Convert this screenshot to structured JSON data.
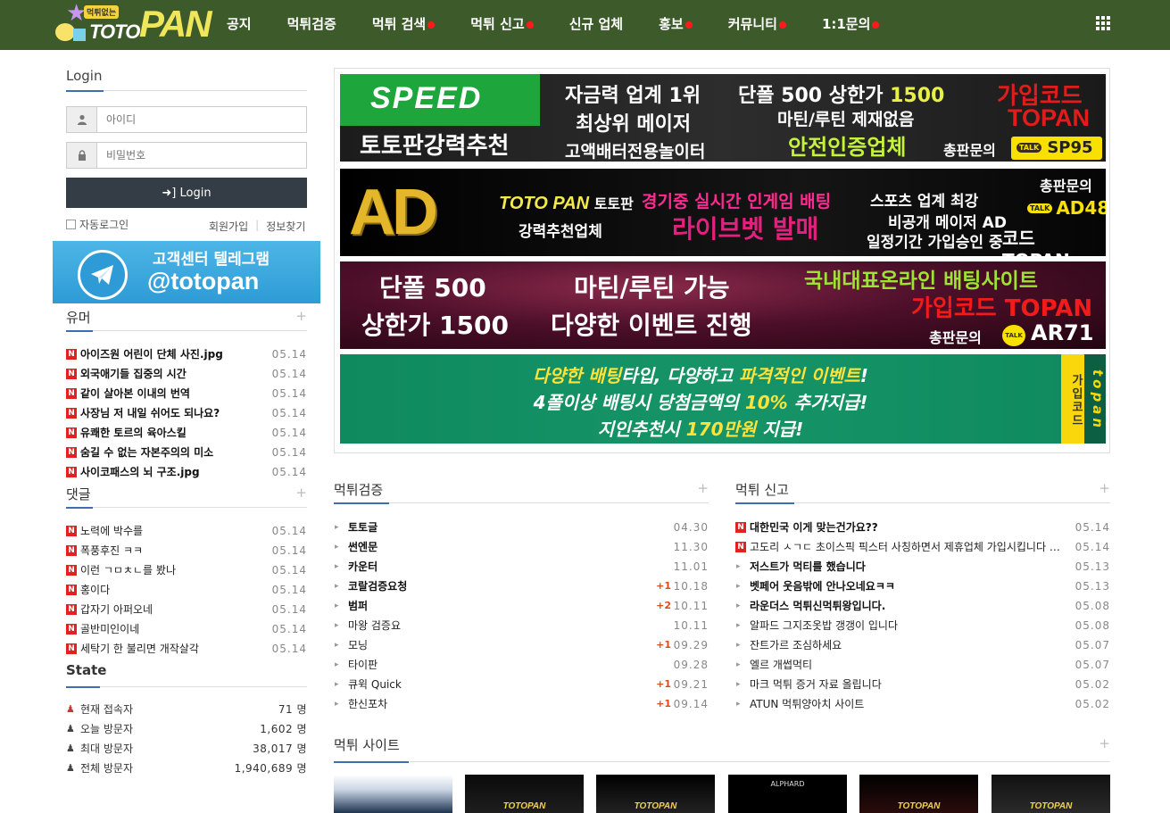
{
  "logo": {
    "tag": "먹튀없는",
    "toto": "TOTO",
    "pan": "PAN"
  },
  "nav": [
    {
      "label": "공지",
      "dot": false
    },
    {
      "label": "먹튀검증",
      "dot": false
    },
    {
      "label": "먹튀 검색",
      "dot": true
    },
    {
      "label": "먹튀 신고",
      "dot": true
    },
    {
      "label": "신규 업체",
      "dot": false
    },
    {
      "label": "홍보",
      "dot": true
    },
    {
      "label": "커뮤니티",
      "dot": true
    },
    {
      "label": "1:1문의",
      "dot": true
    }
  ],
  "login": {
    "title": "Login",
    "id_placeholder": "아이디",
    "pw_placeholder": "비밀번호",
    "button": "Login",
    "auto_login": "자동로그인",
    "signup": "회원가입",
    "find_info": "정보찾기"
  },
  "telegram": {
    "line1": "고객센터 텔레그램",
    "line2": "@totopan"
  },
  "humor": {
    "title": "유머",
    "items": [
      {
        "title": "아이즈원 어린이 단체 사진.jpg",
        "date": "05.14"
      },
      {
        "title": "외국애기들 집중의 시간",
        "date": "05.14"
      },
      {
        "title": "같이 살아본 이내의 번역",
        "date": "05.14"
      },
      {
        "title": "사장님 저 내일 쉬어도 되나요?",
        "date": "05.14"
      },
      {
        "title": "유쾌한 토르의 육아스킬",
        "date": "05.14"
      },
      {
        "title": "숨길 수 없는 자본주의의 미소",
        "date": "05.14"
      },
      {
        "title": "사이코패스의 뇌 구조.jpg",
        "date": "05.14"
      }
    ]
  },
  "comments": {
    "title": "댓글",
    "items": [
      {
        "title": "노력에 박수를",
        "date": "05.14"
      },
      {
        "title": "폭풍후진 ㅋㅋ",
        "date": "05.14"
      },
      {
        "title": "이런 ㄱㅁㅊㄴ를 봤나",
        "date": "05.14"
      },
      {
        "title": "홍이다",
        "date": "05.14"
      },
      {
        "title": "갑자기 아퍼오네",
        "date": "05.14"
      },
      {
        "title": "골반미인이네",
        "date": "05.14"
      },
      {
        "title": "세탁기 한 불리면 개작살각",
        "date": "05.14"
      }
    ]
  },
  "state": {
    "title": "State",
    "items": [
      {
        "label": "현재 접속자",
        "value": "71 명"
      },
      {
        "label": "오늘 방문자",
        "value": "1,602 명"
      },
      {
        "label": "최대 방문자",
        "value": "38,017 명"
      },
      {
        "label": "전체 방문자",
        "value": "1,940,689 명"
      }
    ]
  },
  "banners": {
    "b1": {
      "brand": "SPEED",
      "rec": "토토판강력추천",
      "a1": "자금력 업계 1위",
      "a2": "최상위 메이저",
      "a3": "고액배터전용놀이터",
      "b1a": "단폴 500 상한가 ",
      "b1b": "1500",
      "b2": "마틴/루틴 제재없음",
      "b3": "안전인증업체",
      "c1": "가입코드",
      "c2": "TOPAN",
      "c3": "총판문의",
      "talk_tag": "TALK",
      "talk": "SP95"
    },
    "b2": {
      "brand": "AD",
      "l1a": "TOTO PAN",
      "l1b": " 토토판",
      "l2": "강력추천업체",
      "m1": "경기중 실시간 인게임 배팅",
      "m2": "라이브벳 발매",
      "r1": "스포츠 업계 최강",
      "r2": "비공개 메이저 AD",
      "r3": "일정기간 가입승인 중",
      "s1": "총판문의",
      "talk_tag": "TALK",
      "s2": "AD48",
      "s3": "코드 TOPAN"
    },
    "b3": {
      "a1": "단폴 500",
      "a2": "상한가 1500",
      "b1": "마틴/루틴 가능",
      "b2": "다양한 이벤트 진행",
      "c1": "국내대표온라인 배팅사이트",
      "c2": "가입코드 TOPAN",
      "c3": "총판문의",
      "talk_tag": "TALK",
      "c4": "AR71"
    },
    "b4": {
      "l1a": "다양한 배팅",
      "l1b": "타입, 다양하고 ",
      "l1c": "파격적인 이벤트",
      "l1d": "!",
      "l2a": "4폴이상 배팅시 당첨금액의 ",
      "l2b": "10%",
      "l2c": " 추가지급!",
      "l3a": "지인추천시 ",
      "l3b": "170만원",
      "l3c": " 지급!",
      "side_code": "가입코드",
      "side_name": "topan"
    }
  },
  "verify": {
    "title": "먹튀검증",
    "items": [
      {
        "title": "토토글",
        "date": "04.30",
        "plus": "",
        "bold": true
      },
      {
        "title": "썬엔문",
        "date": "11.30",
        "plus": "",
        "bold": true
      },
      {
        "title": "카운터",
        "date": "11.01",
        "plus": "",
        "bold": true
      },
      {
        "title": "코랄검증요청",
        "date": "10.18",
        "plus": "+1",
        "bold": true
      },
      {
        "title": "범퍼",
        "date": "10.11",
        "plus": "+2",
        "bold": true
      },
      {
        "title": "마왕 검증요",
        "date": "10.11",
        "plus": "",
        "bold": false
      },
      {
        "title": "모닝",
        "date": "09.29",
        "plus": "+1",
        "bold": false
      },
      {
        "title": "타이판",
        "date": "09.28",
        "plus": "",
        "bold": false
      },
      {
        "title": "큐윅 Quick",
        "date": "09.21",
        "plus": "+1",
        "bold": false
      },
      {
        "title": "한신포차",
        "date": "09.14",
        "plus": "+1",
        "bold": false
      }
    ]
  },
  "report": {
    "title": "먹튀 신고",
    "items": [
      {
        "title": "대한민국 이게 맞는건가요??",
        "date": "05.14",
        "badge": true,
        "bold": true
      },
      {
        "title": "고도리 ㅅㄱㄷ 초이스픽 픽스터 사칭하면서 제휴업체 가입시킵니다 속…",
        "date": "05.14",
        "badge": true,
        "bold": false
      },
      {
        "title": "저스트가 먹티를 했습니다",
        "date": "05.13",
        "badge": false,
        "bold": true
      },
      {
        "title": "벳페어 웃음밖에 안나오네요ㅋㅋ",
        "date": "05.13",
        "badge": false,
        "bold": true
      },
      {
        "title": "라운더스 먹튀신먹튀왕입니다.",
        "date": "05.08",
        "badge": false,
        "bold": true
      },
      {
        "title": "알파드 그지조옷밥 갱갱이 입니다",
        "date": "05.08",
        "badge": false,
        "bold": false
      },
      {
        "title": "잔트가르 조심하세요",
        "date": "05.07",
        "badge": false,
        "bold": false
      },
      {
        "title": "엘르 개썹먹티",
        "date": "05.07",
        "badge": false,
        "bold": false
      },
      {
        "title": "마크 먹튀 증거 자료 올립니다",
        "date": "05.02",
        "badge": false,
        "bold": false
      },
      {
        "title": "ATUN 먹튀양아치 사이트",
        "date": "05.02",
        "badge": false,
        "bold": false
      }
    ]
  },
  "sites": {
    "title": "먹튀 사이트",
    "thumbs": [
      {
        "text": ""
      },
      {
        "text": "TOTOPAN"
      },
      {
        "text": "TOTOPAN"
      },
      {
        "text": "ALPHARD"
      },
      {
        "text": "TOTOPAN"
      },
      {
        "text": "TOTOPAN"
      }
    ]
  },
  "colors": {
    "nav_bg": "#3d5a2b",
    "accent_blue": "#3d6fb0",
    "new_badge": "#e42020",
    "plus_red": "#e04a1a"
  }
}
